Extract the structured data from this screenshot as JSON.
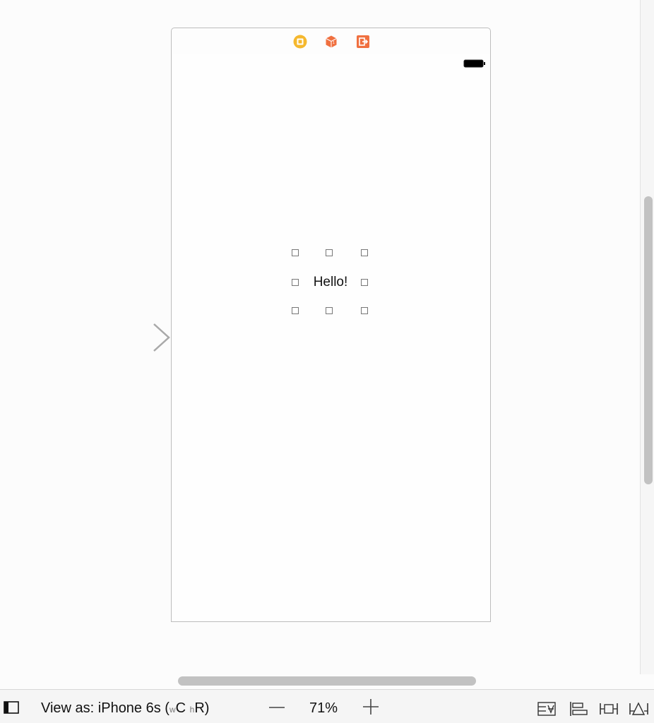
{
  "canvas": {
    "scene": {
      "dock_icons": [
        {
          "name": "view-controller-icon",
          "color": "#f5b82e"
        },
        {
          "name": "first-responder-icon",
          "color": "#f07040"
        },
        {
          "name": "exit-icon",
          "color": "#f07040"
        }
      ],
      "status_bar": {
        "icon": "battery-icon"
      },
      "label": {
        "text": "Hello!"
      }
    },
    "entry_point": {
      "icon": "initial-view-controller-arrow"
    }
  },
  "bottom_bar": {
    "sidebar_toggle_icon": "document-outline-toggle-icon",
    "view_as": {
      "prefix": "View as: iPhone 6s (",
      "width_class_prefix": "w",
      "width_class": "C",
      "height_class_prefix": "h",
      "height_class": "R",
      "suffix": ")"
    },
    "zoom": {
      "value": "71%",
      "zoom_out_icon": "zoom-out-icon",
      "zoom_in_icon": "zoom-in-icon"
    },
    "tools": [
      "embed-in-stack-icon",
      "align-icon",
      "pin-icon",
      "resolve-auto-layout-issues-icon"
    ]
  }
}
